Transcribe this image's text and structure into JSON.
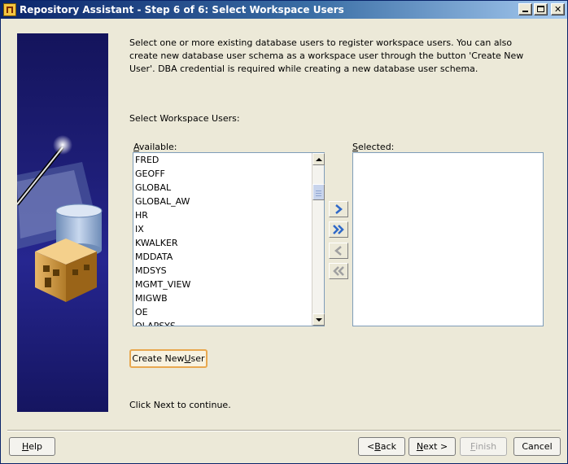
{
  "window": {
    "title": "Repository Assistant - Step 6 of 6: Select Workspace Users",
    "controls": {
      "minimize": "minimize-icon",
      "maximize": "maximize-icon",
      "close": "close-icon"
    }
  },
  "intro_text": "Select one or more existing database users to register workspace users. You can also create new database user schema as a workspace user through the button 'Create New User'. DBA credential is required while creating a new database user schema.",
  "select_label": "Select Workspace Users:",
  "available": {
    "label_first": "A",
    "label_rest": "vailable:",
    "items": [
      "FRED",
      "GEOFF",
      "GLOBAL",
      "GLOBAL_AW",
      "HR",
      "IX",
      "KWALKER",
      "MDDATA",
      "MDSYS",
      "MGMT_VIEW",
      "MIGWB",
      "OE",
      "OLAPSYS"
    ]
  },
  "selected": {
    "label_first": "S",
    "label_rest": "elected:",
    "items": []
  },
  "move_buttons": [
    {
      "name": "add-selected-button",
      "icon": "chevron-right-icon",
      "enabled": true
    },
    {
      "name": "add-all-button",
      "icon": "double-chevron-right-icon",
      "enabled": true
    },
    {
      "name": "remove-selected-button",
      "icon": "chevron-left-icon",
      "enabled": false
    },
    {
      "name": "remove-all-button",
      "icon": "double-chevron-left-icon",
      "enabled": false
    }
  ],
  "create_user_button": {
    "pre": "Create New ",
    "mnemonic": "U",
    "post": "ser"
  },
  "continue_text": "Click Next to continue.",
  "footer": {
    "help": {
      "mnemonic": "H",
      "rest": "elp"
    },
    "back": {
      "pre": "< ",
      "mnemonic": "B",
      "rest": "ack"
    },
    "next": {
      "mnemonic": "N",
      "rest": "ext >"
    },
    "finish": {
      "mnemonic": "F",
      "rest": "inish"
    },
    "cancel": "Cancel"
  },
  "colors": {
    "accent_blue": "#2E68C8",
    "disabled_gray": "#A0A0A0",
    "banner_navy": "#1F1F7A"
  }
}
